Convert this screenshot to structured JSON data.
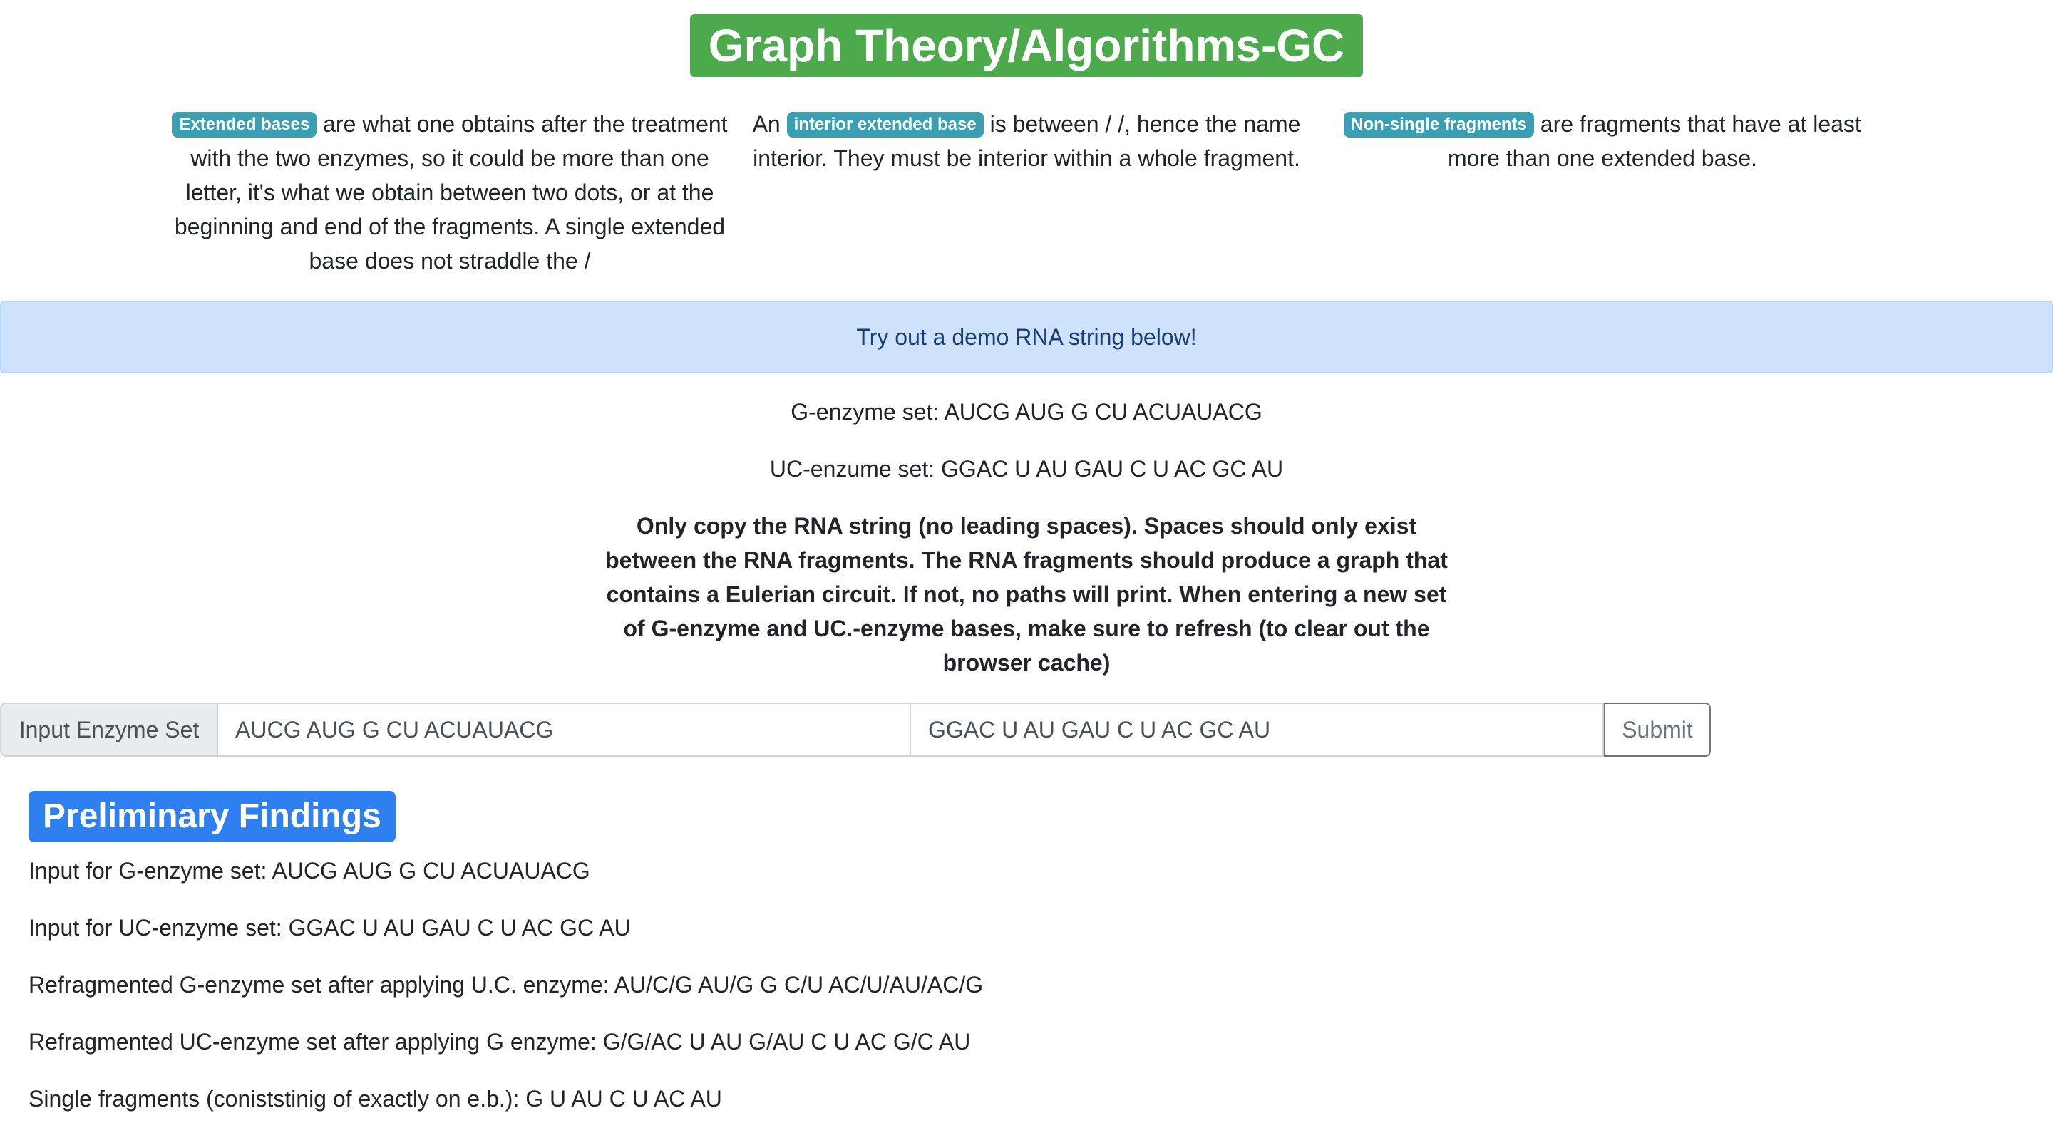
{
  "header": {
    "title": "Graph Theory/Algorithms-GC"
  },
  "definitions": [
    {
      "badge": "Extended bases",
      "text": "are what one obtains after the treatment with the two enzymes, so it could be more than one letter, it's what we obtain between two dots, or at the beginning and end of the fragments. A single extended base does not straddle the /"
    },
    {
      "pre": "An",
      "badge": "interior extended base",
      "text": "is between / /, hence the name interior. They must be interior within a whole fragment."
    },
    {
      "badge": "Non-single fragments",
      "text": "are fragments that have at least more than one extended base."
    }
  ],
  "alert": {
    "text": "Try out a demo RNA string below!"
  },
  "demo": {
    "g_set": "G-enzyme set: AUCG AUG G CU ACUAUACG",
    "uc_set": "UC-enzume set: GGAC U AU GAU C U AC GC AU",
    "note": "Only copy the RNA string (no leading spaces). Spaces should only exist between the RNA fragments. The RNA fragments should produce a graph that contains a Eulerian circuit. If not, no paths will print. When entering a new set of G-enzyme and UC.-enzyme bases, make sure to refresh (to clear out the browser cache)"
  },
  "form": {
    "label": "Input Enzyme Set",
    "g_value": "AUCG AUG G CU ACUAUACG",
    "uc_value": "GGAC U AU GAU C U AC GC AU",
    "submit_label": "Submit"
  },
  "findings": {
    "title": "Preliminary Findings",
    "lines": [
      "Input for G-enzyme set: AUCG AUG G CU ACUAUACG",
      "Input for UC-enzyme set: GGAC U AU GAU C U AC GC AU",
      "Refragmented G-enzyme set after applying U.C. enzyme: AU/C/G AU/G G C/U AC/U/AU/AC/G",
      "Refragmented UC-enzyme set after applying G enzyme: G/G/AC U AU G/AU C U AC G/C AU",
      "Single fragments (coniststinig of exactly on e.b.): G U AU C U AC AU"
    ]
  },
  "colors": {
    "title_bg": "#4caa4d",
    "badge_info": "#3a9fb3",
    "alert_bg": "#cfe2fb",
    "alert_text": "#183f7a",
    "section_badge": "#2e80f0"
  }
}
